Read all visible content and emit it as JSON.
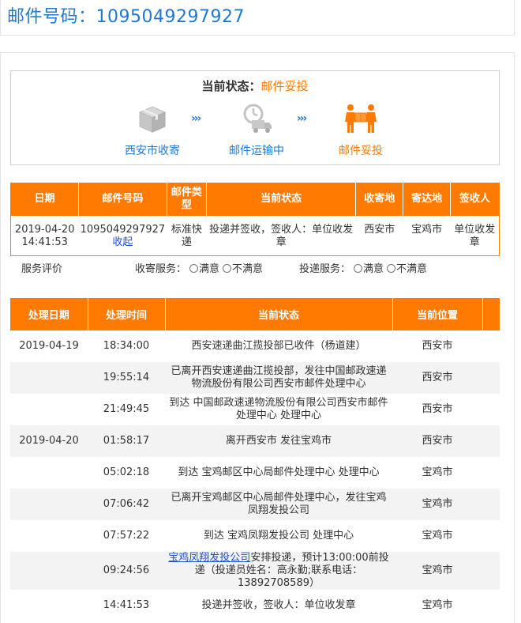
{
  "header": {
    "title": "邮件号码：1095049297927"
  },
  "status": {
    "label": "当前状态：",
    "value": "邮件妥投",
    "steps": [
      "西安市收寄",
      "邮件运输中",
      "邮件妥投"
    ]
  },
  "summary": {
    "headers": [
      "日期",
      "邮件号码",
      "邮件类型",
      "当前状态",
      "收寄地",
      "寄达地",
      "签收人"
    ],
    "row": {
      "date": "2019-04-20 14:41:53",
      "mail_no": "1095049297927",
      "collapse": "收起",
      "type": "标准快递",
      "state": "投递并签收，签收人：单位收发章",
      "origin": "西安市",
      "dest": "宝鸡市",
      "signer": "单位收发章"
    }
  },
  "rating": {
    "label": "服务评价",
    "collect_label": "收寄服务：",
    "deliver_label": "投递服务：",
    "good": "满意",
    "bad": "不满意"
  },
  "tracking": {
    "headers": [
      "处理日期",
      "处理时间",
      "当前状态",
      "当前位置"
    ],
    "rows": [
      {
        "date": "2019-04-19",
        "time": "18:34:00",
        "status": "西安速递曲江揽投部已收件（杨道建）",
        "location": "西安市"
      },
      {
        "date": "",
        "time": "19:55:14",
        "status": "已离开西安速递曲江揽投部，发往中国邮政速递物流股份有限公司西安市邮件处理中心",
        "location": "西安市"
      },
      {
        "date": "",
        "time": "21:49:45",
        "status": "到达 中国邮政速递物流股份有限公司西安市邮件处理中心 处理中心",
        "location": "西安市"
      },
      {
        "date": "2019-04-20",
        "time": "01:58:17",
        "status": "离开西安市 发往宝鸡市",
        "location": "西安市"
      },
      {
        "date": "",
        "time": "05:02:18",
        "status": "到达 宝鸡邮区中心局邮件处理中心 处理中心",
        "location": "宝鸡市"
      },
      {
        "date": "",
        "time": "07:06:42",
        "status": "已离开宝鸡邮区中心局邮件处理中心，发往宝鸡凤翔发投公司",
        "location": "宝鸡市"
      },
      {
        "date": "",
        "time": "07:57:22",
        "status": "到达 宝鸡凤翔发投公司 处理中心",
        "location": "宝鸡市"
      },
      {
        "date": "",
        "time": "09:24:56",
        "status_link": "宝鸡凤翔发投公司",
        "status": "安排投递，预计13:00:00前投递（投递员姓名：高永勤;联系电话：13892708589）",
        "location": "宝鸡市"
      },
      {
        "date": "",
        "time": "14:41:53",
        "status": "投递并签收，签收人：单位收发章",
        "location": "宝鸡市"
      }
    ]
  }
}
